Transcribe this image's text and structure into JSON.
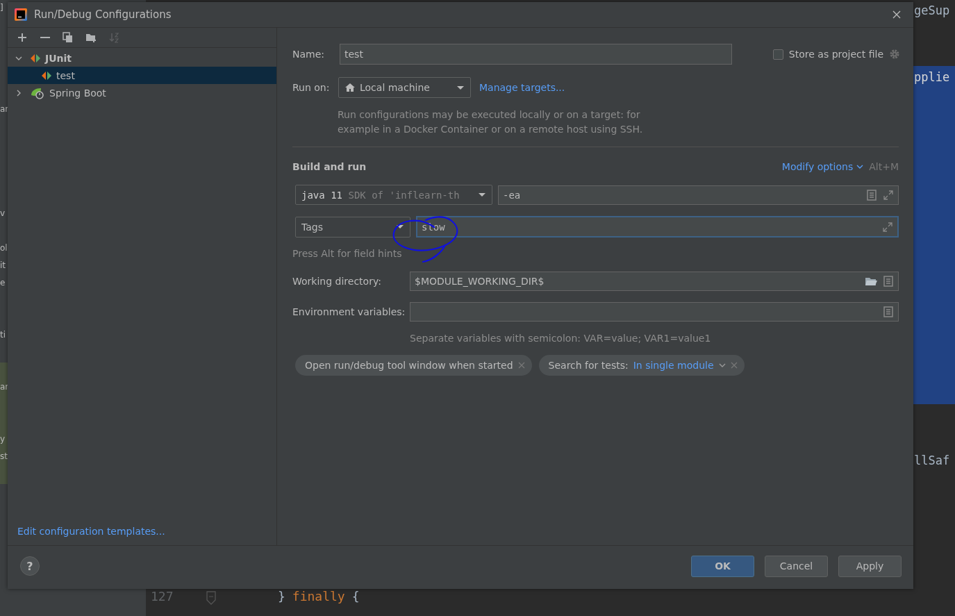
{
  "background_editor": {
    "left_fragments": [
      "]",
      "ar",
      "v",
      "ol",
      "it",
      "e",
      "ti",
      "ar",
      "y",
      "st"
    ],
    "right_fragments": [
      "geSup",
      "pplie",
      "llSaf"
    ],
    "line_number": "127",
    "code_line": [
      "}",
      "finally",
      "{"
    ]
  },
  "window": {
    "title": "Run/Debug Configurations"
  },
  "toolbar": [
    {
      "kind": "add",
      "disabled": false
    },
    {
      "kind": "remove",
      "disabled": false
    },
    {
      "kind": "copy",
      "disabled": false
    },
    {
      "kind": "folder",
      "disabled": false
    },
    {
      "kind": "sort",
      "disabled": true
    }
  ],
  "tree": [
    {
      "label": "JUnit",
      "kind": "junit",
      "expanded": true,
      "selected": false,
      "children": [
        {
          "label": "test",
          "kind": "junit",
          "selected": true
        }
      ]
    },
    {
      "label": "Spring Boot",
      "kind": "spring",
      "expanded": false,
      "selected": false
    }
  ],
  "templates_link": "Edit configuration templates...",
  "name_field": {
    "label": "Name:",
    "value": "test"
  },
  "store_as_project_file": {
    "label": "Store as project file",
    "checked": false
  },
  "run_on": {
    "label": "Run on:",
    "value": "Local machine",
    "link": "Manage targets..."
  },
  "run_on_hint": "Run configurations may be executed locally or on a target: for example in a Docker Container or on a remote host using SSH.",
  "build_and_run": {
    "title": "Build and run",
    "modify_options": "Modify options",
    "shortcut": "Alt+M",
    "jdk": {
      "name": "java 11",
      "detail": "SDK of 'inflearn-th"
    },
    "vm_options": "-ea",
    "test_kind": "Tags",
    "tags_value": "slow",
    "tags_focused": true,
    "hint": "Press Alt for field hints"
  },
  "working_directory": {
    "label": "Working directory:",
    "value": "$MODULE_WORKING_DIR$"
  },
  "environment_variables": {
    "label": "Environment variables:",
    "hint": "Separate variables with semicolon: VAR=value; VAR1=value1"
  },
  "option_chips": [
    {
      "kind": "plain",
      "label": "Open run/debug tool window when started"
    },
    {
      "kind": "choice",
      "label": "Search for tests:",
      "value": "In single module"
    }
  ],
  "help": "?",
  "buttons": [
    {
      "label": "OK",
      "default": true
    },
    {
      "label": "Cancel",
      "default": false
    },
    {
      "label": "Apply",
      "default": false
    }
  ]
}
